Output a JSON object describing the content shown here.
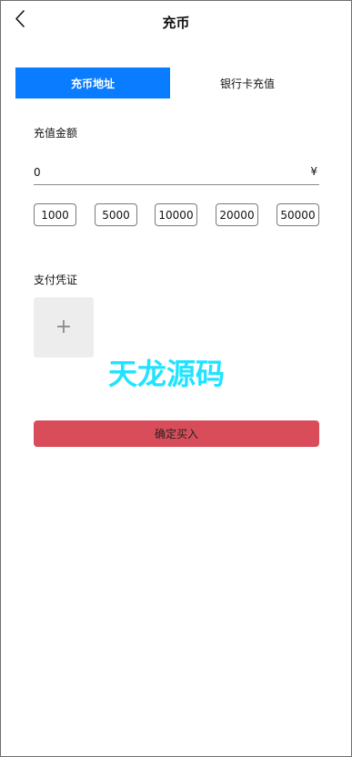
{
  "header": {
    "title": "充币"
  },
  "tabs": [
    {
      "label": "充币地址",
      "active": true
    },
    {
      "label": "银行卡充值",
      "active": false
    }
  ],
  "amount": {
    "label": "充值金额",
    "value": "0",
    "currency": "¥",
    "presets": [
      "1000",
      "5000",
      "10000",
      "20000",
      "50000"
    ]
  },
  "proof": {
    "label": "支付凭证",
    "upload_symbol": "+"
  },
  "watermark": "天龙源码",
  "submit": {
    "label": "确定买入"
  },
  "colors": {
    "accent": "#0a7cff",
    "submit": "#d94d5a",
    "watermark": "#21e3ff"
  }
}
